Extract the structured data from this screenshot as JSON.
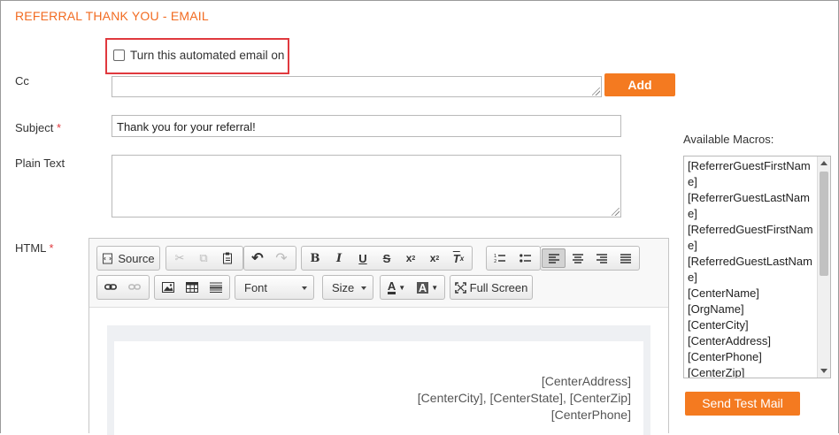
{
  "form": {
    "title": "REFERRAL THANK YOU - EMAIL",
    "auto_email_label": "Turn this automated email on",
    "cc_label": "Cc",
    "add_label": "Add",
    "subject_label": "Subject",
    "subject_required": "*",
    "subject_value": "Thank you for your referral!",
    "plain_text_label": "Plain Text",
    "html_label": "HTML",
    "html_required": "*"
  },
  "macros": {
    "title": "Available Macros:",
    "items": [
      "[ReferrerGuestFirstName]",
      "[ReferrerGuestLastName]",
      "[ReferredGuestFirstName]",
      "[ReferredGuestLastName]",
      "[CenterName]",
      "[OrgName]",
      "[CenterCity]",
      "[CenterAddress]",
      "[CenterPhone]",
      "[CenterZip]"
    ],
    "send_label": "Send Test Mail"
  },
  "editor": {
    "source_label": "Source",
    "font_label": "Font",
    "size_label": "Size",
    "fullscreen_label": "Full Screen",
    "content_lines": [
      "[CenterAddress]",
      "[CenterCity], [CenterState], [CenterZip]",
      "[CenterPhone]"
    ]
  },
  "colors": {
    "accent": "#f47a20",
    "heading": "#f26b21",
    "highlight_border": "#e0393e"
  }
}
